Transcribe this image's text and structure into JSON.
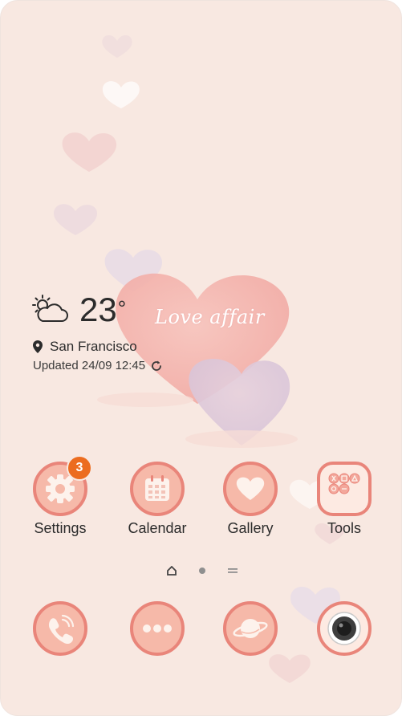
{
  "weather": {
    "temperature": "23",
    "degree": "°",
    "tagline": "Love affair",
    "location": "San Francisco",
    "updated": "Updated 24/09 12:45",
    "icon": "partly-cloudy-icon"
  },
  "apps": [
    {
      "label": "Settings",
      "icon": "gear-icon",
      "badge": "3"
    },
    {
      "label": "Calendar",
      "icon": "calendar-icon"
    },
    {
      "label": "Gallery",
      "icon": "heart-icon"
    },
    {
      "label": "Tools",
      "icon": "tools-folder-icon"
    }
  ],
  "pager": {
    "items": [
      "home-indicator",
      "page-dot",
      "menu-indicator"
    ]
  },
  "dock": [
    {
      "icon": "phone-icon"
    },
    {
      "icon": "messages-icon"
    },
    {
      "icon": "browser-planet-icon"
    },
    {
      "icon": "camera-icon"
    }
  ],
  "colors": {
    "background": "#f8e8e1",
    "icon_fill": "#f6b9a9",
    "icon_ring": "#e9857a",
    "badge": "#ec6c1f"
  }
}
